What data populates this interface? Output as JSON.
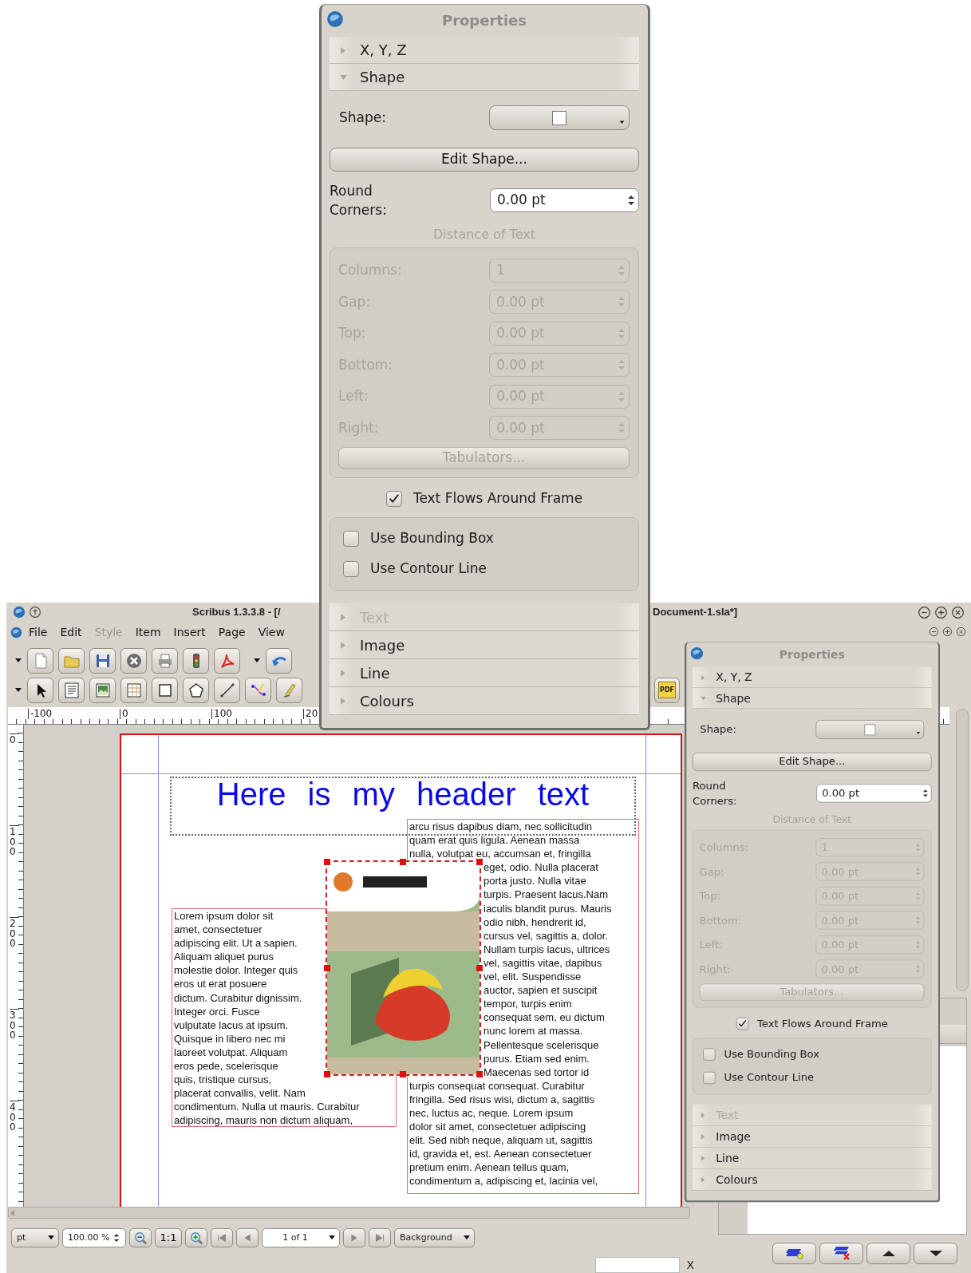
{
  "window": {
    "title_left": "Scribus 1.3.3.8 - [/",
    "title_right": "Document-1.sla*]"
  },
  "menu": [
    {
      "label": "File",
      "disabled": false
    },
    {
      "label": "Edit",
      "disabled": false
    },
    {
      "label": "Style",
      "disabled": true
    },
    {
      "label": "Item",
      "disabled": false
    },
    {
      "label": "Insert",
      "disabled": false
    },
    {
      "label": "Page",
      "disabled": false
    },
    {
      "label": "View",
      "disabled": false
    }
  ],
  "pdf_button_label": "PDF",
  "ruler": {
    "horizontal": [
      "-100",
      "0",
      "100",
      "20"
    ],
    "vertical": [
      "0",
      "100",
      "200",
      "300",
      "400"
    ]
  },
  "document": {
    "header": "Here is my header text",
    "left_frame": {
      "beside_image": [
        "Lorem ipsum dolor sit",
        "amet, consectetuer",
        "adipiscing elit. Ut a sapien.",
        "Aliquam aliquet purus",
        "molestie dolor. Integer quis",
        "eros ut erat posuere",
        "dictum. Curabitur dignissim.",
        "Integer orci. Fusce",
        "vulputate lacus at ipsum.",
        "Quisque in libero nec mi",
        "laoreet volutpat. Aliquam",
        "eros pede, scelerisque"
      ],
      "below_image": [
        "quis, tristique cursus,",
        "placerat convallis, velit. Nam",
        "condimentum. Nulla ut mauris. Curabitur",
        "adipiscing, mauris non dictum aliquam,"
      ]
    },
    "right_frame": {
      "above_image": [
        "arcu risus dapibus diam, nec sollicitudin",
        "quam erat quis ligula. Aenean massa",
        "nulla, volutpat eu, accumsan et, fringilla"
      ],
      "beside_image": [
        "eget, odio. Nulla placerat",
        "porta justo. Nulla vitae",
        "turpis. Praesent lacus.Nam",
        "iaculis blandit purus. Mauris",
        "odio nibh, hendrerit id,",
        "cursus vel, sagittis a, dolor.",
        "Nullam turpis lacus, ultrices",
        "vel, sagittis vitae, dapibus",
        "vel, elit. Suspendisse",
        "auctor, sapien et suscipit",
        "tempor, turpis enim",
        "consequat sem, eu dictum",
        "nunc lorem at massa.",
        "Pellentesque scelerisque",
        "purus. Etiam sed enim.",
        "Maecenas sed tortor id"
      ],
      "below_image": [
        "turpis consequat consequat. Curabitur",
        "fringilla. Sed risus wisi, dictum a, sagittis",
        "nec, luctus ac, neque. Lorem ipsum",
        "dolor sit amet, consectetuer adipiscing",
        "elit. Sed nibh neque, aliquam ut, sagittis",
        "id, gravida et, est. Aenean consectetuer",
        "pretium enim. Aenean tellus quam,",
        "condimentum a, adipiscing et, lacinia vel,"
      ]
    }
  },
  "status_bar": {
    "unit": "pt",
    "zoom": "100.00 %",
    "zoom_reset": "1:1",
    "page": "1 of 1",
    "layer": "Background"
  },
  "coordinate_label": "X",
  "properties_panels": [
    {
      "title": "Properties",
      "sections_top": [
        {
          "label": "X, Y, Z",
          "expanded": false
        },
        {
          "label": "Shape",
          "expanded": true
        }
      ],
      "shape_label": "Shape:",
      "edit_shape_button": "Edit Shape...",
      "round_corners": {
        "label": "Round Corners:",
        "value": "0.00 pt"
      },
      "distance": {
        "heading": "Distance of Text",
        "disabled": true,
        "fields": [
          {
            "label": "Columns:",
            "value": "1"
          },
          {
            "label": "Gap:",
            "value": "0.00 pt"
          },
          {
            "label": "Top:",
            "value": "0.00 pt"
          },
          {
            "label": "Bottom:",
            "value": "0.00 pt"
          },
          {
            "label": "Left:",
            "value": "0.00 pt"
          },
          {
            "label": "Right:",
            "value": "0.00 pt"
          }
        ],
        "tabulators_button": "Tabulators..."
      },
      "text_flows": {
        "label": "Text Flows Around Frame",
        "checked": true
      },
      "contour_options": [
        {
          "label": "Use Bounding Box",
          "checked": false
        },
        {
          "label": "Use Contour Line",
          "checked": false
        }
      ],
      "sections_bottom": [
        {
          "label": "Text",
          "expanded": false,
          "disabled": true
        },
        {
          "label": "Image",
          "expanded": false,
          "disabled": false
        },
        {
          "label": "Line",
          "expanded": false,
          "disabled": false
        },
        {
          "label": "Colours",
          "expanded": false,
          "disabled": false
        }
      ]
    },
    {
      "title": "Properties",
      "sections_top": [
        {
          "label": "X, Y, Z",
          "expanded": false
        },
        {
          "label": "Shape",
          "expanded": true
        }
      ],
      "shape_label": "Shape:",
      "edit_shape_button": "Edit Shape...",
      "round_corners": {
        "label": "Round Corners:",
        "value": "0.00 pt"
      },
      "distance": {
        "heading": "Distance of Text",
        "disabled": true,
        "fields": [
          {
            "label": "Columns:",
            "value": "1"
          },
          {
            "label": "Gap:",
            "value": "0.00 pt"
          },
          {
            "label": "Top:",
            "value": "0.00 pt"
          },
          {
            "label": "Bottom:",
            "value": "0.00 pt"
          },
          {
            "label": "Left:",
            "value": "0.00 pt"
          },
          {
            "label": "Right:",
            "value": "0.00 pt"
          }
        ],
        "tabulators_button": "Tabulators..."
      },
      "text_flows": {
        "label": "Text Flows Around Frame",
        "checked": true
      },
      "contour_options": [
        {
          "label": "Use Bounding Box",
          "checked": false
        },
        {
          "label": "Use Contour Line",
          "checked": false
        }
      ],
      "sections_bottom": [
        {
          "label": "Text",
          "expanded": false,
          "disabled": true
        },
        {
          "label": "Image",
          "expanded": false,
          "disabled": false
        },
        {
          "label": "Line",
          "expanded": false,
          "disabled": false
        },
        {
          "label": "Colours",
          "expanded": false,
          "disabled": false
        }
      ]
    }
  ]
}
